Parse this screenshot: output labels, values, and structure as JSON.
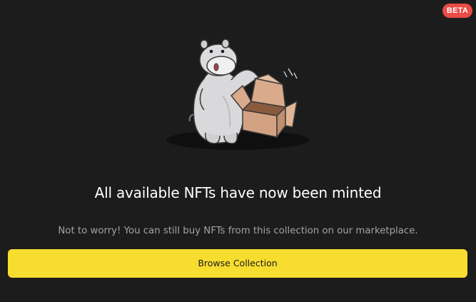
{
  "badge": {
    "label": "BETA",
    "color": "#e94b45"
  },
  "illustration": {
    "icon": "hippo-with-box-illustration"
  },
  "content": {
    "headline": "All available NFTs have now been minted",
    "subtext": "Not to worry! You can still buy NFTs from this collection on our marketplace."
  },
  "actions": {
    "browse_label": "Browse Collection",
    "button_color": "#f7dd2f"
  },
  "theme": {
    "background": "#1c1c1d"
  }
}
